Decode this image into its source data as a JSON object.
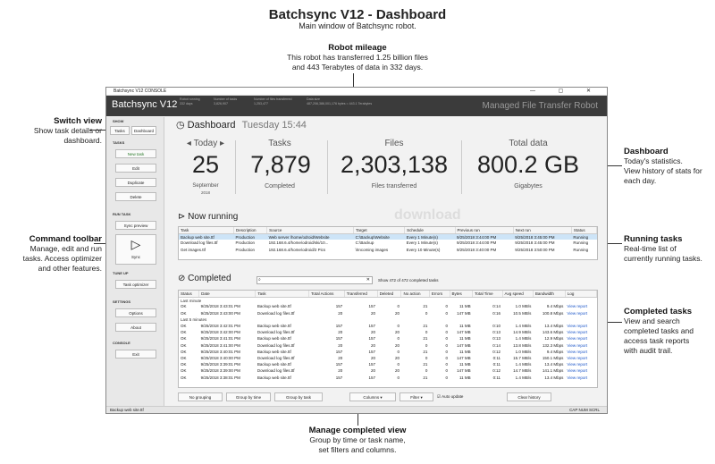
{
  "header": {
    "title": "Batchsync V12 - Dashboard",
    "subtitle": "Main window of Batchsync robot."
  },
  "callouts": {
    "mileage": {
      "title": "Robot mileage",
      "l1": "This robot has transferred 1.25 billion files",
      "l2": "and 443 Terabytes of data in 332 days."
    },
    "switch": {
      "title": "Switch view",
      "l1": "Show task details or",
      "l2": "dashboard."
    },
    "command": {
      "title": "Command toolbar",
      "l1": "Manage, edit and run",
      "l2": "tasks. Access optimizer",
      "l3": "and other features."
    },
    "dashboard": {
      "title": "Dashboard",
      "l1": "Today's statistics.",
      "l2": "View history of stats for",
      "l3": "each day."
    },
    "running": {
      "title": "Running tasks",
      "l1": "Real-time list of",
      "l2": "currently running tasks."
    },
    "completed": {
      "title": "Completed tasks",
      "l1": "View and search",
      "l2": "completed tasks and",
      "l3": "access task reports",
      "l4": "with audit trail."
    },
    "manage": {
      "title": "Manage completed view",
      "l1": "Group by time or task name,",
      "l2": "set filters and columns."
    }
  },
  "window": {
    "title": "Batchsync V12 CONSOLE",
    "logo": "Batchsync V12",
    "right_title": "Managed File Transfer Robot",
    "stats": [
      {
        "label": "Robot running",
        "value": "332 days"
      },
      {
        "label": "Number of tasks",
        "value": "3,826,907"
      },
      {
        "label": "Number of files transferred",
        "value": "1,253,477"
      },
      {
        "label": "Data size",
        "value": "487,206,386,001,176 bytes = 443.1 Terabytes"
      }
    ]
  },
  "sidebar": {
    "show": "SHOW",
    "tasks_tab": "Tasks",
    "dashboard_tab": "Dashboard",
    "tasks": "TASKS",
    "new_task": "New task",
    "edit": "Edit",
    "duplicate": "Duplicate",
    "delete": "Delete",
    "run_task": "RUN TASK",
    "sync_preview": "Sync preview",
    "sync": "Sync",
    "tune_up": "TUNE UP",
    "task_optimizer": "Task optimizer",
    "settings": "SETTINGS",
    "options": "Options",
    "about": "About",
    "console": "CONSOLE",
    "exit": "Exit"
  },
  "dash": {
    "title": "Dashboard",
    "time": "Tuesday 15:44",
    "today_label": "Today",
    "day": "25",
    "month": "September",
    "year": "2018",
    "tasks_label": "Tasks",
    "tasks_value": "7,879",
    "tasks_sub": "Completed",
    "files_label": "Files",
    "files_value": "2,303,138",
    "files_sub": "Files transferred",
    "data_label": "Total data",
    "data_value": "800.2 GB",
    "data_sub": "Gigabytes"
  },
  "running": {
    "title": "Now running",
    "columns": [
      "Task",
      "Description",
      "Source",
      "Target",
      "Schedule",
      "Previous run",
      "Next run",
      "Status"
    ],
    "rows": [
      [
        "Backup web site.ttf",
        "Production",
        "Web server /home/odroid/Website",
        "C:\\Backup\\Website",
        "Every 1 Minute(s)",
        "9/25/2018 3:44:00 PM",
        "9/25/2018 3:45:00 PM",
        "Running"
      ],
      [
        "Download log files.ttf",
        "Production",
        "192.168.6.4/home/odroid/ski/10...",
        "C:\\Backup",
        "Every 1 Minute(s)",
        "9/25/2018 3:44:00 PM",
        "9/25/2018 3:45:00 PM",
        "Running"
      ],
      [
        "Get images.ttf",
        "Production",
        "192.168.6.4/home/odroid/2 Pics",
        "\\\\Incoming images",
        "Every 10 Minute(s)",
        "9/25/2018 3:40:00 PM",
        "9/25/2018 3:50:00 PM",
        "Running"
      ]
    ]
  },
  "completed": {
    "title": "Completed",
    "search_placeholder": "",
    "count_text": "Show 472 of 472 completed tasks",
    "columns": [
      "Status",
      "Date",
      "Task",
      "Total Actions",
      "Transferred",
      "Deleted",
      "No action",
      "Errors",
      "Bytes",
      "Total Time",
      "Avg speed",
      "Bandwidth",
      "Log"
    ],
    "group1": "Last minute",
    "group2": "Last 5 minutes",
    "rows1": [
      [
        "OK",
        "9/25/2018 3:43:01 PM",
        "Backup web site.ttf",
        "157",
        "157",
        "0",
        "21",
        "0",
        "11 MB",
        "0:14",
        "1.0 MB/s",
        "9.4 Mbps",
        "View report"
      ],
      [
        "OK",
        "9/25/2018 3:43:00 PM",
        "Download log files.ttf",
        "20",
        "20",
        "20",
        "0",
        "0",
        "147 MB",
        "0:16",
        "10.5 MB/s",
        "100.8 Mbps",
        "View report"
      ]
    ],
    "rows2": [
      [
        "OK",
        "9/25/2018 3:42:01 PM",
        "Backup web site.ttf",
        "157",
        "157",
        "0",
        "21",
        "0",
        "11 MB",
        "0:10",
        "1.4 MB/s",
        "13.4 Mbps",
        "View report"
      ],
      [
        "OK",
        "9/25/2018 3:42:00 PM",
        "Download log files.ttf",
        "20",
        "20",
        "20",
        "0",
        "0",
        "147 MB",
        "0:13",
        "14.9 MB/s",
        "143.6 Mbps",
        "View report"
      ],
      [
        "OK",
        "9/25/2018 3:41:01 PM",
        "Backup web site.ttf",
        "157",
        "157",
        "0",
        "21",
        "0",
        "11 MB",
        "0:13",
        "1.4 MB/s",
        "12.9 Mbps",
        "View report"
      ],
      [
        "OK",
        "9/25/2018 3:41:00 PM",
        "Download log files.ttf",
        "20",
        "20",
        "20",
        "0",
        "0",
        "147 MB",
        "0:14",
        "13.8 MB/s",
        "132.3 Mbps",
        "View report"
      ],
      [
        "OK",
        "9/25/2018 3:40:01 PM",
        "Backup web site.ttf",
        "157",
        "157",
        "0",
        "21",
        "0",
        "11 MB",
        "0:12",
        "1.0 MB/s",
        "9.4 Mbps",
        "View report"
      ],
      [
        "OK",
        "9/25/2018 3:40:00 PM",
        "Download log files.ttf",
        "20",
        "20",
        "20",
        "0",
        "0",
        "147 MB",
        "0:11",
        "15.7 MB/s",
        "150.1 Mbps",
        "View report"
      ],
      [
        "OK",
        "9/25/2018 3:39:01 PM",
        "Backup web site.ttf",
        "157",
        "157",
        "0",
        "21",
        "0",
        "11 MB",
        "0:11",
        "1.4 MB/s",
        "13.4 Mbps",
        "View report"
      ],
      [
        "OK",
        "9/25/2018 3:39:00 PM",
        "Download log files.ttf",
        "20",
        "20",
        "20",
        "0",
        "0",
        "147 MB",
        "0:12",
        "14.7 MB/s",
        "141.1 Mbps",
        "View report"
      ],
      [
        "OK",
        "9/25/2018 3:38:01 PM",
        "Backup web site.ttf",
        "157",
        "157",
        "0",
        "21",
        "0",
        "11 MB",
        "0:11",
        "1.4 MB/s",
        "13.4 Mbps",
        "View report"
      ]
    ]
  },
  "bottom": {
    "no_grouping": "No grouping",
    "group_time": "Group by time",
    "group_task": "Group by task",
    "columns": "Columns",
    "filter": "Filter",
    "auto_update": "Auto update",
    "clear_history": "Clear history"
  },
  "statusbar": {
    "left": "Backup web site.ttf",
    "right": "CAP   NUM   SCRL"
  },
  "watermark": "download"
}
